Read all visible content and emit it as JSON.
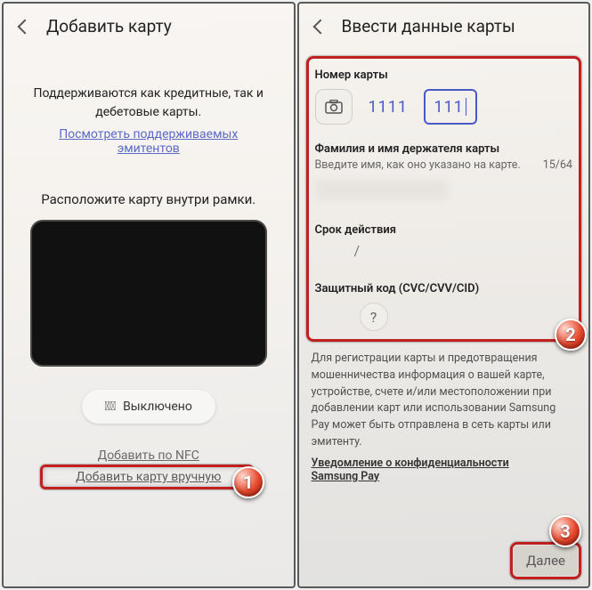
{
  "screen1": {
    "title": "Добавить карту",
    "lead_l1": "Поддерживаются как кредитные, так и",
    "lead_l2": "дебетовые карты.",
    "link_l1": "Посмотреть поддерживаемых",
    "link_l2": "эмитентов",
    "instruct": "Расположите карту внутри рамки.",
    "flash": "Выключено",
    "nfc": "Добавить по NFC",
    "manual": "Добавить карту вручную"
  },
  "screen2": {
    "title": "Ввести данные карты",
    "cardnum_label": "Номер карты",
    "cardnum_box1": "1111",
    "cardnum_box2": "111",
    "holder_label": "Фамилия и имя держателя карты",
    "holder_hint": "Введите имя, как оно указано на карте.",
    "holder_counter": "15/64",
    "expiry_label": "Срок действия",
    "expiry_sep": "/",
    "cvc_label": "Защитный код (CVC/CVV/CID)",
    "legal": "Для регистрации карты и предотвращения мошенничества информация о вашей карте, устройстве, счете и/или местоположении при добавлении карт или использовании Samsung Pay может быть отправлена в сеть карты или эмитенту.",
    "legal_link_l1": "Уведомление о конфиденциальности",
    "legal_link_l2": "Samsung Pay",
    "next": "Далее"
  },
  "badges": {
    "b1": "1",
    "b2": "2",
    "b3": "3"
  }
}
